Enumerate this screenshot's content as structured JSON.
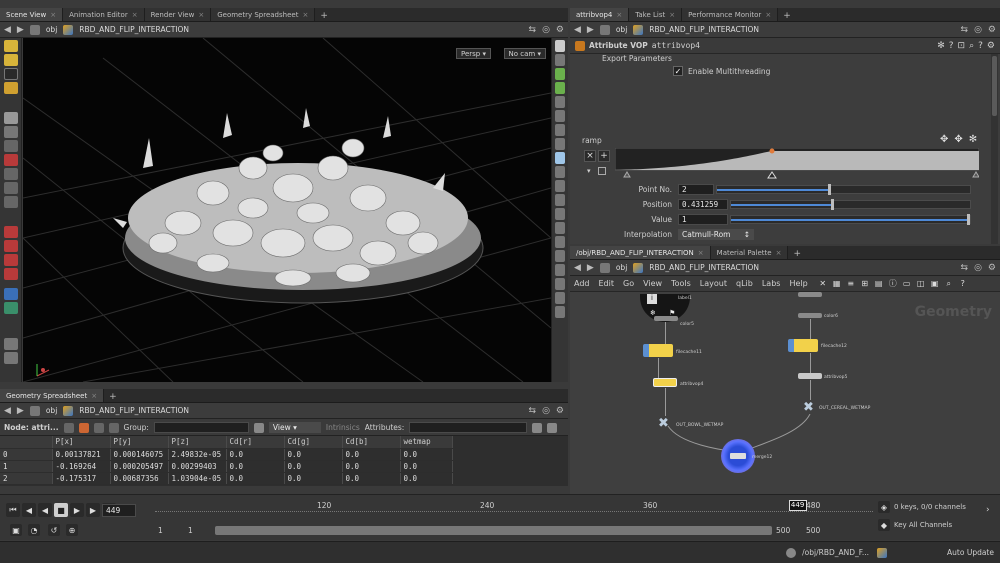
{
  "left_tabs": [
    {
      "label": "Scene View",
      "active": true
    },
    {
      "label": "Animation Editor"
    },
    {
      "label": "Render View"
    },
    {
      "label": "Geometry Spreadsheet"
    }
  ],
  "path": {
    "obj": "obj",
    "node": "RBD_AND_FLIP_INTERACTION"
  },
  "viewport": {
    "persp": "Persp",
    "cam": "No cam"
  },
  "spreadsheet": {
    "tab": "Geometry Spreadsheet",
    "node_label": "Node: attri...",
    "group_label": "Group:",
    "view_label": "View",
    "intrinsics_label": "Intrinsics",
    "attributes_label": "Attributes:",
    "columns": [
      "",
      "P[x]",
      "P[y]",
      "P[z]",
      "Cd[r]",
      "Cd[g]",
      "Cd[b]",
      "wetmap"
    ],
    "rows": [
      [
        "0",
        "0.00137821",
        "0.000146075",
        "2.49832e-05",
        "0.0",
        "0.0",
        "0.0",
        "0.0"
      ],
      [
        "1",
        "-0.169264",
        "0.000205497",
        "0.00299403",
        "0.0",
        "0.0",
        "0.0",
        "0.0"
      ],
      [
        "2",
        "-0.175317",
        "0.00687356",
        "1.03904e-05",
        "0.0",
        "0.0",
        "0.0",
        "0.0"
      ]
    ]
  },
  "right_top_tabs": [
    {
      "label": "attribvop4",
      "active": true
    },
    {
      "label": "Take List"
    },
    {
      "label": "Performance Monitor"
    }
  ],
  "params": {
    "type_label": "Attribute VOP",
    "node_name": "attribvop4",
    "export_parameters": "Export Parameters",
    "enable_mt": "Enable Multithreading",
    "ramp_label": "ramp",
    "point_no_label": "Point No.",
    "point_no": "2",
    "position_label": "Position",
    "position": "0.431259",
    "value_label": "Value",
    "value": "1",
    "interp_label": "Interpolation",
    "interp": "Catmull-Rom",
    "point_no_slider": 0.45,
    "position_slider": 0.43,
    "value_slider": 1.0
  },
  "net_tabs": [
    {
      "label": "/obj/RBD_AND_FLIP_INTERACTION",
      "active": true
    },
    {
      "label": "Material Palette"
    }
  ],
  "net_menu": [
    "Add",
    "Edit",
    "Go",
    "View",
    "Tools",
    "Layout",
    "qLib",
    "Labs",
    "Help"
  ],
  "net_watermark": "Geometry",
  "nodes": {
    "left": [
      "label1",
      "color5",
      "filecache11",
      "attribvop4",
      "OUT_BOWL_WETMAP"
    ],
    "right": [
      "color6",
      "filecache12",
      "attribvop5",
      "OUT_CEREAL_WETMAP"
    ],
    "merge": "merge12"
  },
  "timeline": {
    "frame": "449",
    "ticks": [
      "120",
      "240",
      "360",
      "480"
    ],
    "marker": "449",
    "start": "1",
    "start2": "1",
    "end": "500",
    "end2": "500",
    "keys": "0 keys, 0/0 channels",
    "key_all": "Key All Channels",
    "frame_fraction": 0.895
  },
  "status": {
    "path": "/obj/RBD_AND_F...",
    "auto_update": "Auto Update"
  }
}
